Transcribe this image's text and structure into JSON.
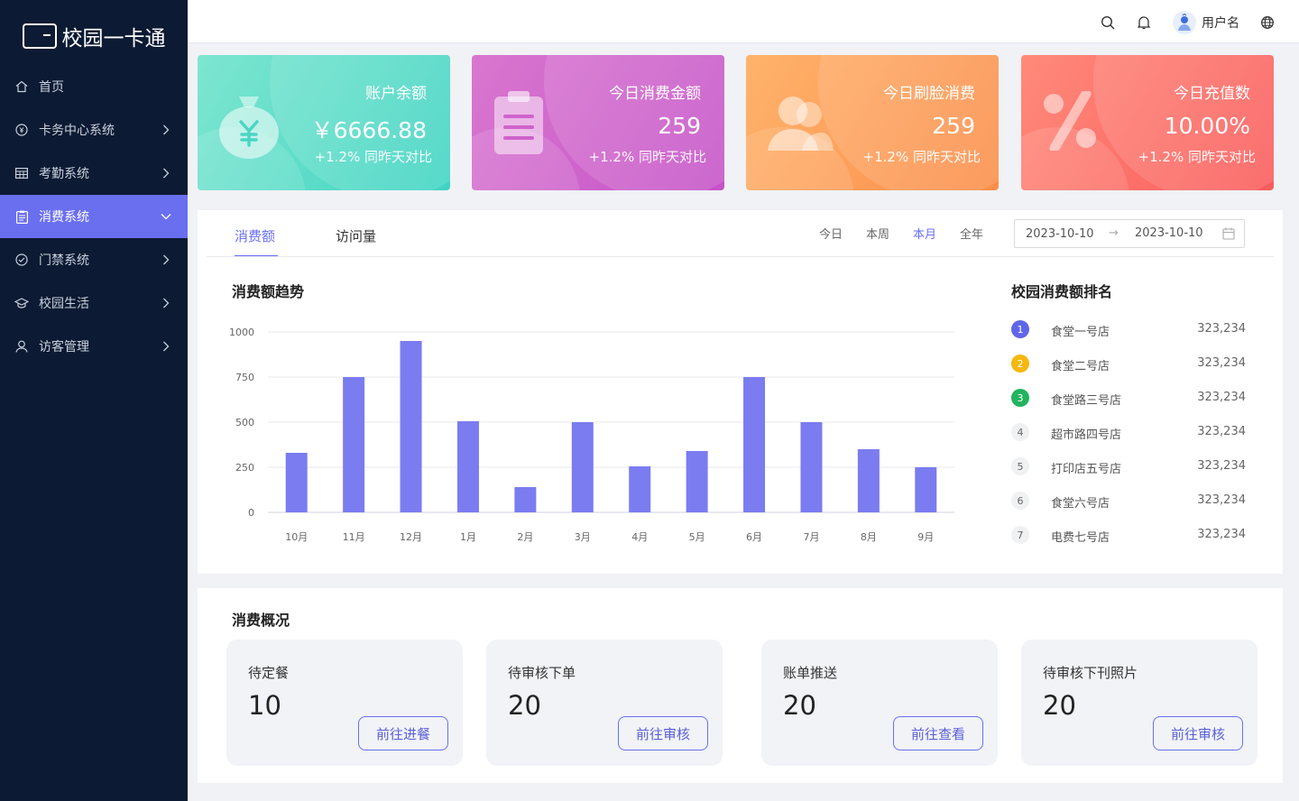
{
  "app": {
    "title": "校园一卡通"
  },
  "sidebar": {
    "items": [
      {
        "label": "首页",
        "icon": "home-icon"
      },
      {
        "label": "卡务中心系统",
        "icon": "coin-icon"
      },
      {
        "label": "考勤系统",
        "icon": "table-icon"
      },
      {
        "label": "消费系统",
        "icon": "clipboard-icon",
        "active": true
      },
      {
        "label": "门禁系统",
        "icon": "check-circle-icon"
      },
      {
        "label": "校园生活",
        "icon": "graduation-cap-icon"
      },
      {
        "label": "访客管理",
        "icon": "user-icon"
      }
    ]
  },
  "header": {
    "username": "用户名"
  },
  "stats": [
    {
      "title": "账户余额",
      "value": "￥6666.88",
      "sub": "+1.2% 同昨天对比",
      "color_from": "#7ee6d0",
      "color_to": "#3fd4c2",
      "icon": "money-bag-icon"
    },
    {
      "title": "今日消费金额",
      "value": "259",
      "sub": "+1.2% 同昨天对比",
      "color_from": "#d977cf",
      "color_to": "#c553c8",
      "icon": "clipboard-icon"
    },
    {
      "title": "今日刷脸消费",
      "value": "259",
      "sub": "+1.2% 同昨天对比",
      "color_from": "#ffb36b",
      "color_to": "#fb8d4a",
      "icon": "users-icon"
    },
    {
      "title": "今日充值数",
      "value": "10.00%",
      "sub": "+1.2% 同昨天对比",
      "color_from": "#ff8a7a",
      "color_to": "#fa5b5b",
      "icon": "percent-icon"
    }
  ],
  "chart_panel": {
    "tabs": [
      "消费额",
      "访问量"
    ],
    "ranges": [
      "今日",
      "本周",
      "本月",
      "全年"
    ],
    "active_range": "本月",
    "date_start": "2023-10-10",
    "date_end": "2023-10-10",
    "chart_title": "消费额趋势",
    "rank_title": "校园消费额排名"
  },
  "chart_data": {
    "type": "bar",
    "categories": [
      "10月",
      "11月",
      "12月",
      "1月",
      "2月",
      "3月",
      "4月",
      "5月",
      "6月",
      "7月",
      "8月",
      "9月"
    ],
    "values": [
      330,
      750,
      950,
      505,
      140,
      500,
      255,
      340,
      750,
      500,
      350,
      250
    ],
    "yticks": [
      0,
      250,
      500,
      750,
      1000
    ],
    "ylim": [
      0,
      1000
    ],
    "color": "#7b7cf0",
    "grid": true
  },
  "ranking": [
    {
      "no": "1",
      "name": "食堂一号店",
      "value": "323,234",
      "color": "#6066e8"
    },
    {
      "no": "2",
      "name": "食堂二号店",
      "value": "323,234",
      "color": "#f5b80f"
    },
    {
      "no": "3",
      "name": "食堂路三号店",
      "value": "323,234",
      "color": "#22b35e"
    },
    {
      "no": "4",
      "name": "超市路四号店",
      "value": "323,234"
    },
    {
      "no": "5",
      "name": "打印店五号店",
      "value": "323,234"
    },
    {
      "no": "6",
      "name": "食堂六号店",
      "value": "323,234"
    },
    {
      "no": "7",
      "name": "电费七号店",
      "value": "323,234"
    }
  ],
  "overview": {
    "title": "消费概况",
    "cards": [
      {
        "label": "待定餐",
        "num": "10",
        "button": "前往进餐"
      },
      {
        "label": "待审核下单",
        "num": "20",
        "button": "前往审核"
      },
      {
        "label": "账单推送",
        "num": "20",
        "button": "前往查看"
      },
      {
        "label": "待审核下刊照片",
        "num": "20",
        "button": "前往审核"
      }
    ]
  }
}
